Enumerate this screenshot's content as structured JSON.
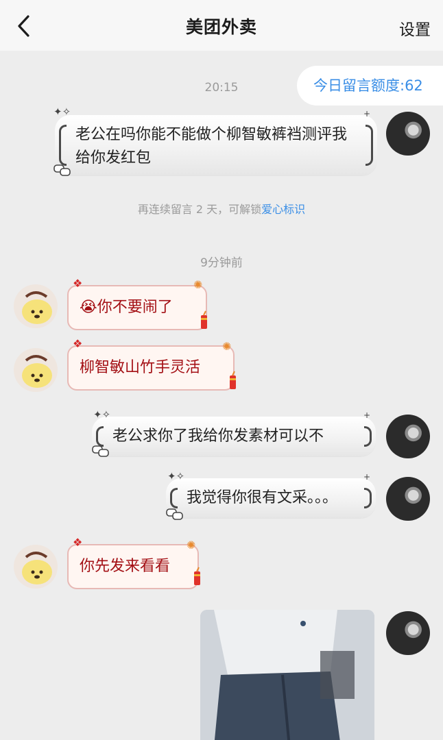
{
  "header": {
    "title": "美团外卖",
    "settings_label": "设置"
  },
  "quota": {
    "label": "今日留言额度:62"
  },
  "times": [
    "20:15",
    "9分钟前"
  ],
  "hint": {
    "prefix": "再连续留言 2 天，可解锁",
    "link": "爱心标识"
  },
  "messages": [
    {
      "side": "right",
      "text": "老公在吗你能不能做个柳智敏裤裆测评我给你发红包"
    },
    {
      "side": "left",
      "text": "你不要闹了",
      "emoji": "😭"
    },
    {
      "side": "left",
      "text": "柳智敏山竹手灵活"
    },
    {
      "side": "right",
      "text": "老公求你了我给你发素材可以不"
    },
    {
      "side": "right",
      "text": "我觉得你很有文采。。。"
    },
    {
      "side": "left",
      "text": "你先发来看看"
    },
    {
      "side": "right",
      "type": "image"
    }
  ],
  "colors": {
    "accent": "#3a8ee6",
    "left_text": "#a30f14",
    "background": "#ededed"
  }
}
